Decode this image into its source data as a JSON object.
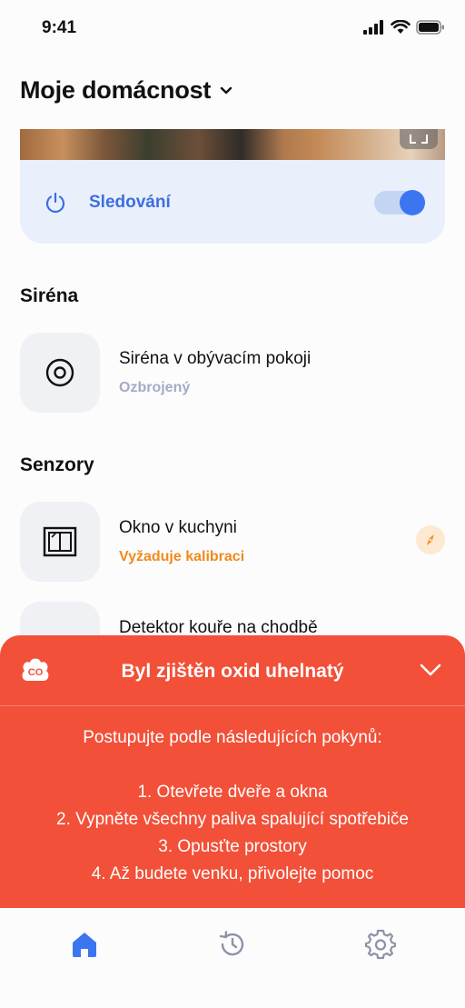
{
  "status_bar": {
    "time": "9:41"
  },
  "header": {
    "title": "Moje domácnost"
  },
  "monitoring": {
    "label": "Sledování",
    "enabled": true
  },
  "sections": {
    "siren": {
      "title": "Siréna",
      "device": {
        "name": "Siréna v obývacím pokoji",
        "status": "Ozbrojený"
      }
    },
    "sensors": {
      "title": "Senzory",
      "devices": [
        {
          "name": "Okno v kuchyni",
          "status": "Vyžaduje kalibraci"
        },
        {
          "name": "Detektor kouře na chodbě"
        }
      ]
    }
  },
  "alert": {
    "badge": "CO",
    "title": "Byl zjištěn oxid uhelnatý",
    "intro": "Postupujte podle následujících pokynů:",
    "steps": [
      "1. Otevřete dveře a okna",
      "2. Vypněte všechny paliva spalující spotřebiče",
      "3. Opusťte prostory",
      "4. Až budete venku, přivolejte pomoc"
    ]
  },
  "colors": {
    "accent": "#3b76f0",
    "alert": "#f25038",
    "warning": "#f08a1c",
    "muted": "#a5abc5"
  },
  "tabs": [
    {
      "icon": "home-icon",
      "active": true
    },
    {
      "icon": "history-icon",
      "active": false
    },
    {
      "icon": "gear-icon",
      "active": false
    }
  ]
}
